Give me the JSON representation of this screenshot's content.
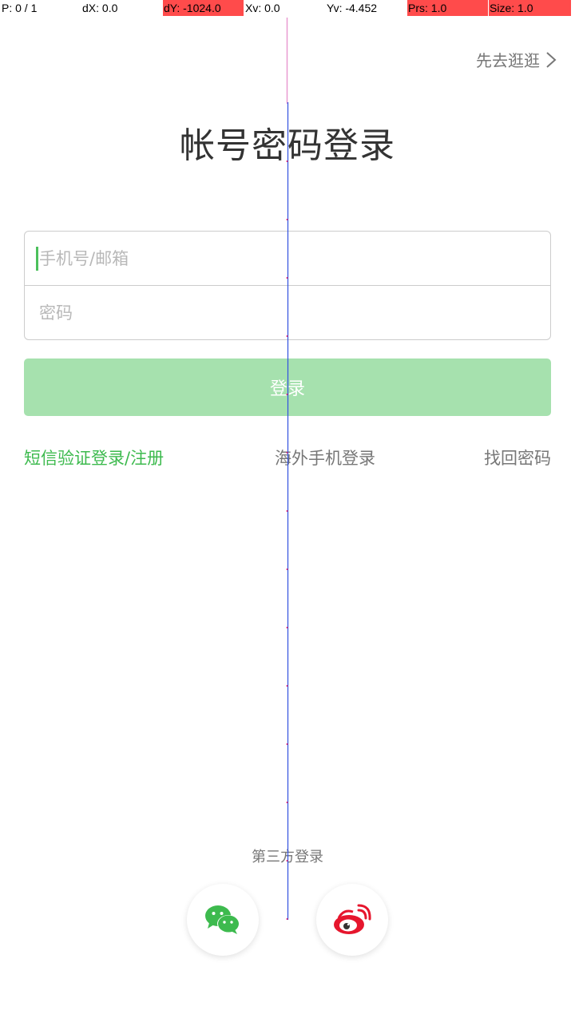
{
  "debug_bar": {
    "pointers": "P: 0 / 1",
    "dx": "dX: 0.0",
    "dy": "dY: -1024.0",
    "xv": "Xv: 0.0",
    "yv": "Yv: -4.452",
    "prs": "Prs: 1.0",
    "size": "Size: 1.0"
  },
  "header": {
    "skip_label": "先去逛逛",
    "skip_icon": "chevron-right-icon"
  },
  "title": "帐号密码登录",
  "form": {
    "account_placeholder": "手机号/邮箱",
    "password_placeholder": "密码"
  },
  "login_button_label": "登录",
  "links": {
    "sms": "短信验证登录/注册",
    "overseas": "海外手机登录",
    "forgot": "找回密码"
  },
  "third_party": {
    "label": "第三方登录",
    "wechat_icon": "wechat-icon",
    "weibo_icon": "weibo-icon"
  },
  "colors": {
    "accent_green": "#3dba4e",
    "button_disabled": "#a6e1ae",
    "debug_highlight": "#ff4b4b",
    "weibo_red": "#e6162d"
  }
}
